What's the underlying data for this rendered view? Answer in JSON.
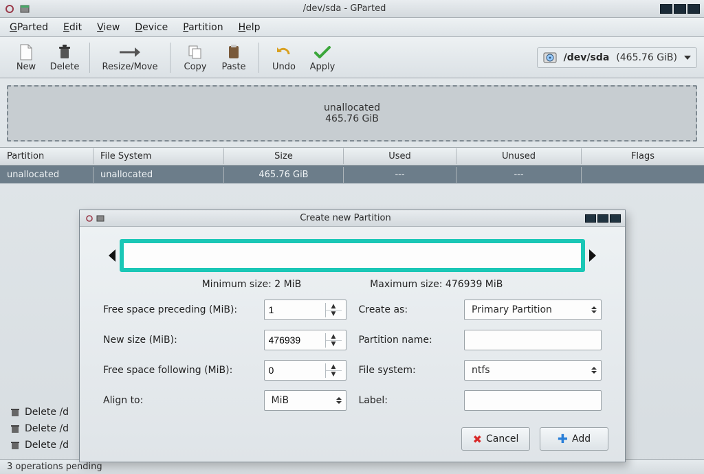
{
  "window": {
    "title": "/dev/sda - GParted"
  },
  "menubar": {
    "items": [
      "GParted",
      "Edit",
      "View",
      "Device",
      "Partition",
      "Help"
    ]
  },
  "toolbar": {
    "new": "New",
    "delete": "Delete",
    "resize": "Resize/Move",
    "copy": "Copy",
    "paste": "Paste",
    "undo": "Undo",
    "apply": "Apply",
    "device_label": "/dev/sda",
    "device_size": "(465.76 GiB)"
  },
  "graph": {
    "label": "unallocated",
    "size": "465.76 GiB"
  },
  "table": {
    "headers": {
      "partition": "Partition",
      "filesystem": "File System",
      "size": "Size",
      "used": "Used",
      "unused": "Unused",
      "flags": "Flags"
    },
    "row": {
      "partition": "unallocated",
      "filesystem": "unallocated",
      "size": "465.76 GiB",
      "used": "---",
      "unused": "---",
      "flags": ""
    }
  },
  "pending": {
    "rows": [
      "Delete /d",
      "Delete /d",
      "Delete /d"
    ],
    "status": "3 operations pending"
  },
  "dialog": {
    "title": "Create new Partition",
    "min_label": "Minimum size: 2 MiB",
    "max_label": "Maximum size: 476939 MiB",
    "labels": {
      "free_before": "Free space preceding (MiB):",
      "new_size": "New size (MiB):",
      "free_after": "Free space following (MiB):",
      "align_to": "Align to:",
      "create_as": "Create as:",
      "part_name": "Partition name:",
      "filesystem": "File system:",
      "label": "Label:"
    },
    "values": {
      "free_before": "1",
      "new_size": "476939",
      "free_after": "0",
      "align_to": "MiB",
      "create_as": "Primary Partition",
      "part_name": "",
      "filesystem": "ntfs",
      "label": ""
    },
    "buttons": {
      "cancel": "Cancel",
      "add": "Add"
    }
  }
}
